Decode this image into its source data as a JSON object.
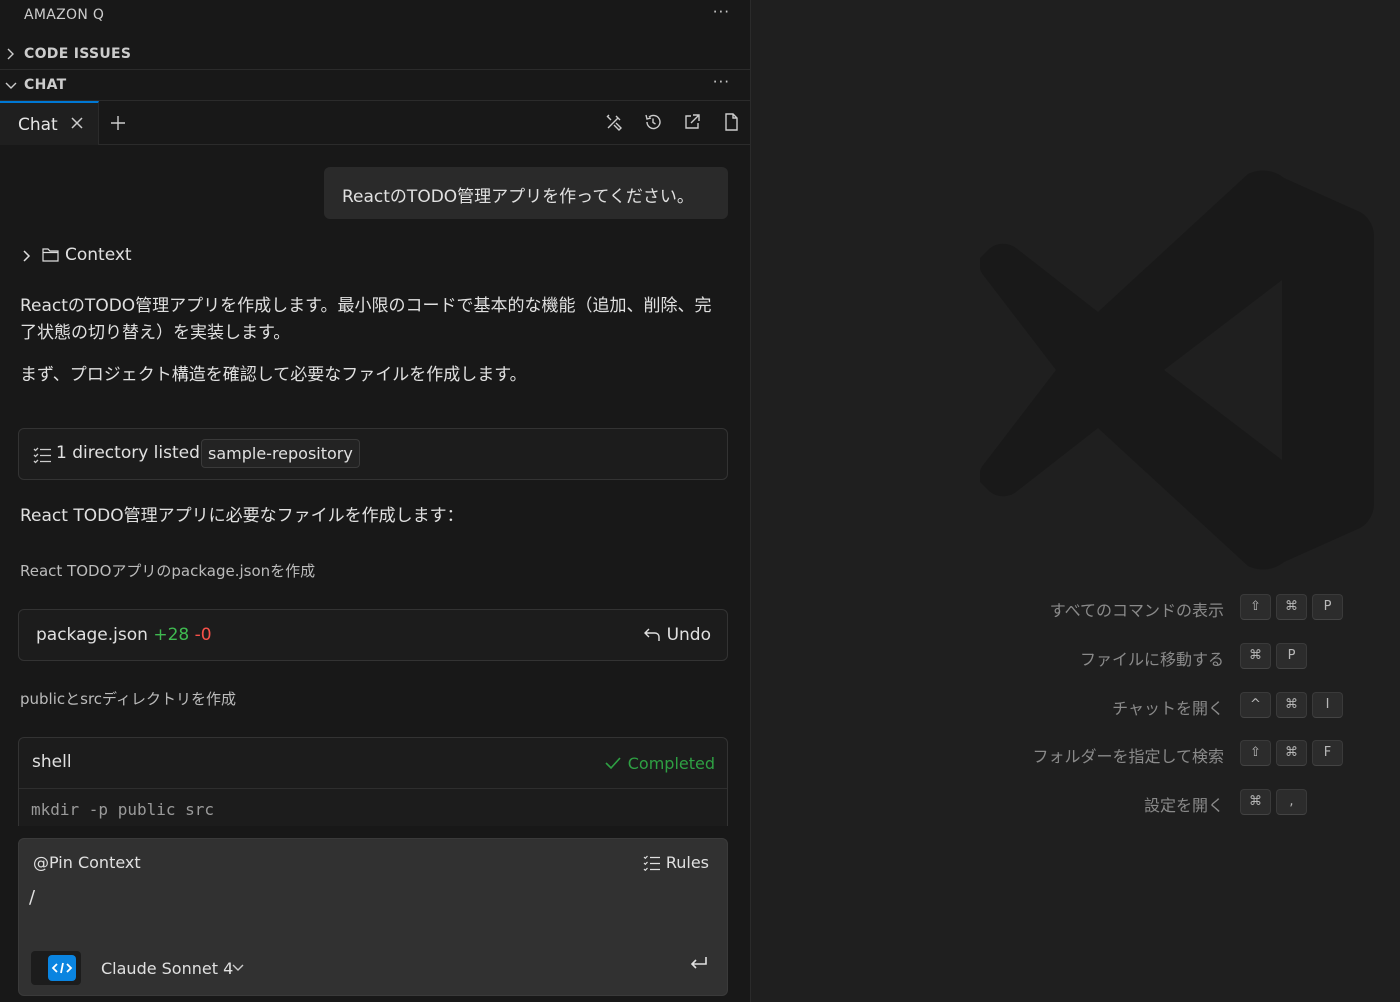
{
  "sidebar": {
    "title": "AMAZON Q",
    "more_label": "···",
    "sections": {
      "code_issues": "CODE ISSUES",
      "chat": "CHAT"
    },
    "chat_more_label": "···"
  },
  "tabs": {
    "active_label": "Chat",
    "close_icon": "close-icon",
    "new_icon": "plus-icon",
    "toolbar_icons": [
      "tools-icon",
      "history-icon",
      "open-external-icon",
      "file-icon"
    ]
  },
  "chat": {
    "user_message": "ReactのTODO管理アプリを作ってください。",
    "context_label": "Context",
    "response_p1": "ReactのTODO管理アプリを作成します。最小限のコードで基本的な機能（追加、削除、完了状態の切り替え）を実装します。",
    "response_p2": "まず、プロジェクト構造を確認して必要なファイルを作成します。",
    "dir_listed": "1 directory listed",
    "dir_chip": "sample-repository",
    "response_p3": "React TODO管理アプリに必要なファイルを作成します：",
    "step1": "React TODOアプリのpackage.jsonを作成",
    "file_name": "package.json",
    "file_added": "+28",
    "file_removed": "-0",
    "undo_label": "Undo",
    "step2": "publicとsrcディレクトリを作成",
    "shell_title": "shell",
    "shell_status": "Completed",
    "shell_command": "mkdir -p public src"
  },
  "input": {
    "pin_context": "@Pin Context",
    "rules_label": "Rules",
    "typed_text": "/",
    "model_name": "Claude Sonnet 4"
  },
  "shortcuts": [
    {
      "label": "すべてのコマンドの表示",
      "keys": [
        "⇧",
        "⌘",
        "P"
      ]
    },
    {
      "label": "ファイルに移動する",
      "keys": [
        "⌘",
        "P"
      ]
    },
    {
      "label": "チャットを開く",
      "keys": [
        "^",
        "⌘",
        "I"
      ]
    },
    {
      "label": "フォルダーを指定して検索",
      "keys": [
        "⇧",
        "⌘",
        "F"
      ]
    },
    {
      "label": "設定を開く",
      "keys": [
        "⌘",
        ","
      ]
    }
  ],
  "colors": {
    "accent": "#0078d4",
    "added": "#3fb950",
    "removed": "#f85149",
    "completed": "#2ea043"
  }
}
